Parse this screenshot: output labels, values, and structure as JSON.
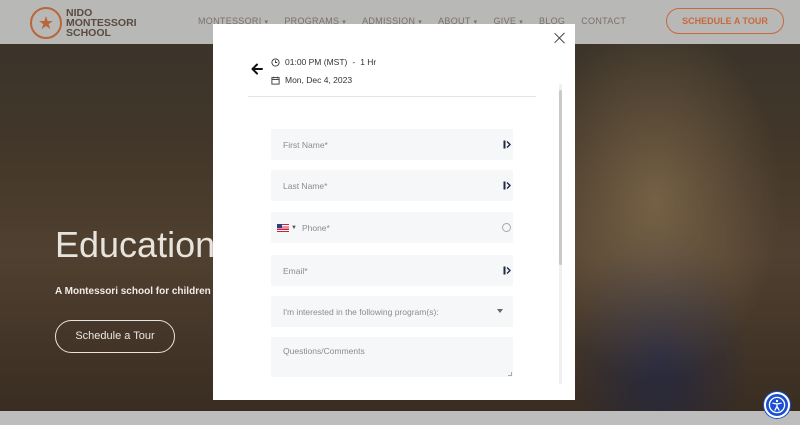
{
  "site": {
    "logo_line1": "NIDO",
    "logo_line2": "MONTESSORI",
    "logo_line3": "SCHOOL",
    "nav": [
      {
        "label": "MONTESSORI"
      },
      {
        "label": "PROGRAMS"
      },
      {
        "label": "ADMISSION"
      },
      {
        "label": "ABOUT"
      },
      {
        "label": "GIVE"
      },
      {
        "label": "BLOG"
      },
      {
        "label": "CONTACT"
      }
    ],
    "header_cta": "SCHEDULE A TOUR",
    "hero_title": "Education",
    "hero_subtitle": "A Montessori school for children",
    "hero_cta": "Schedule a Tour"
  },
  "modal": {
    "time": "01:00 PM (MST)",
    "separator": "-",
    "duration": "1 Hr",
    "date": "Mon, Dec 4, 2023",
    "fields": {
      "first_name": "First Name*",
      "last_name": "Last Name*",
      "phone": "Phone*",
      "email": "Email*",
      "program": "I'm interested in the following program(s):",
      "comments": "Questions/Comments"
    }
  },
  "colors": {
    "accent": "#c8693c",
    "a11y": "#1a4fd1"
  }
}
